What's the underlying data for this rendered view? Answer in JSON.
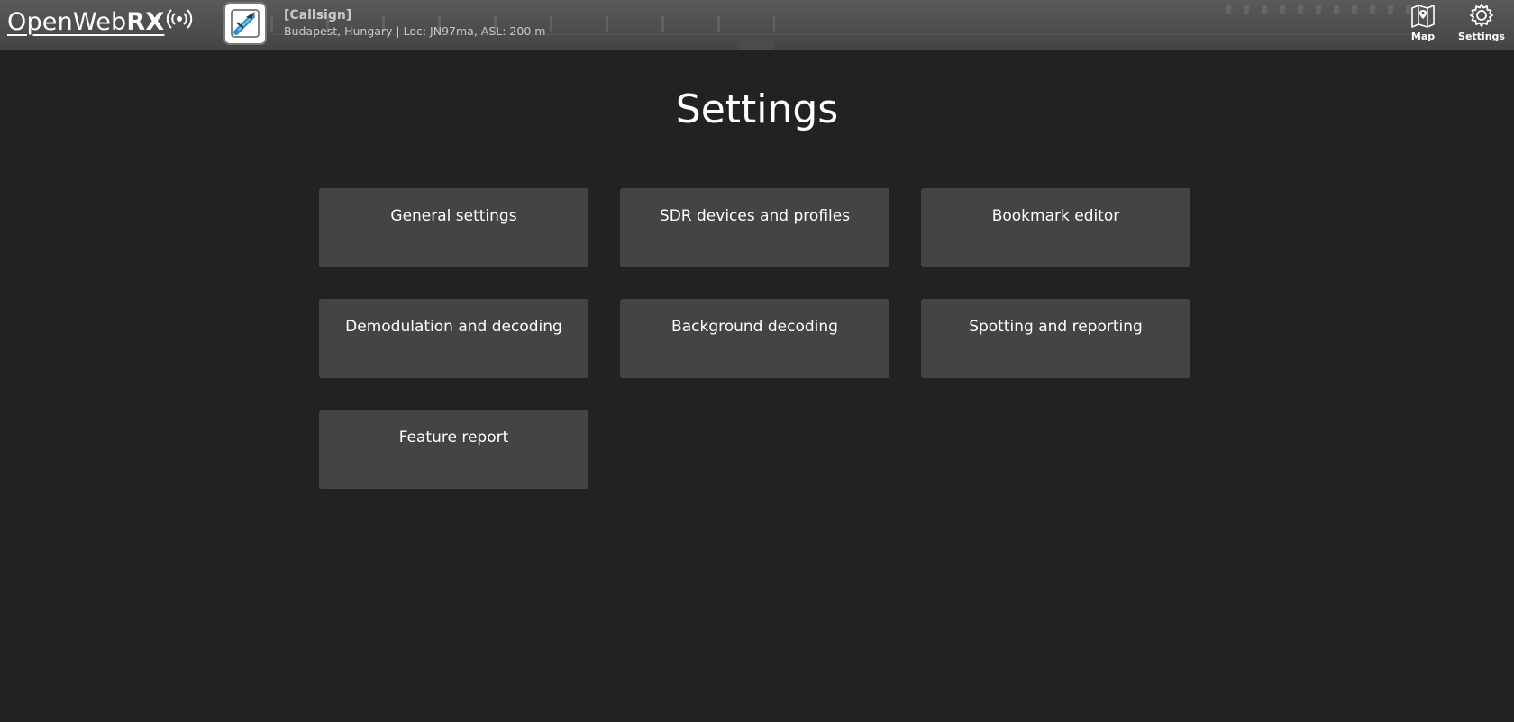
{
  "header": {
    "logo": {
      "open": "Open",
      "web": "Web",
      "rx": "RX"
    },
    "callsign": "[Callsign]",
    "location": "Budapest, Hungary | Loc: JN97ma, ASL: 200 m",
    "nav": [
      {
        "label": "Map",
        "icon": "map-icon"
      },
      {
        "label": "Settings",
        "icon": "gear-icon"
      }
    ]
  },
  "main": {
    "title": "Settings",
    "sections": [
      {
        "label": "General settings"
      },
      {
        "label": "SDR devices and profiles"
      },
      {
        "label": "Bookmark editor"
      },
      {
        "label": "Demodulation and decoding"
      },
      {
        "label": "Background decoding"
      },
      {
        "label": "Spotting and reporting"
      },
      {
        "label": "Feature report"
      }
    ]
  },
  "colors": {
    "page_background": "#222222",
    "header_background": "#4a4a4a",
    "tile_background": "#444444",
    "text": "#ffffff",
    "accent_avatar": "#3aa0d8"
  }
}
